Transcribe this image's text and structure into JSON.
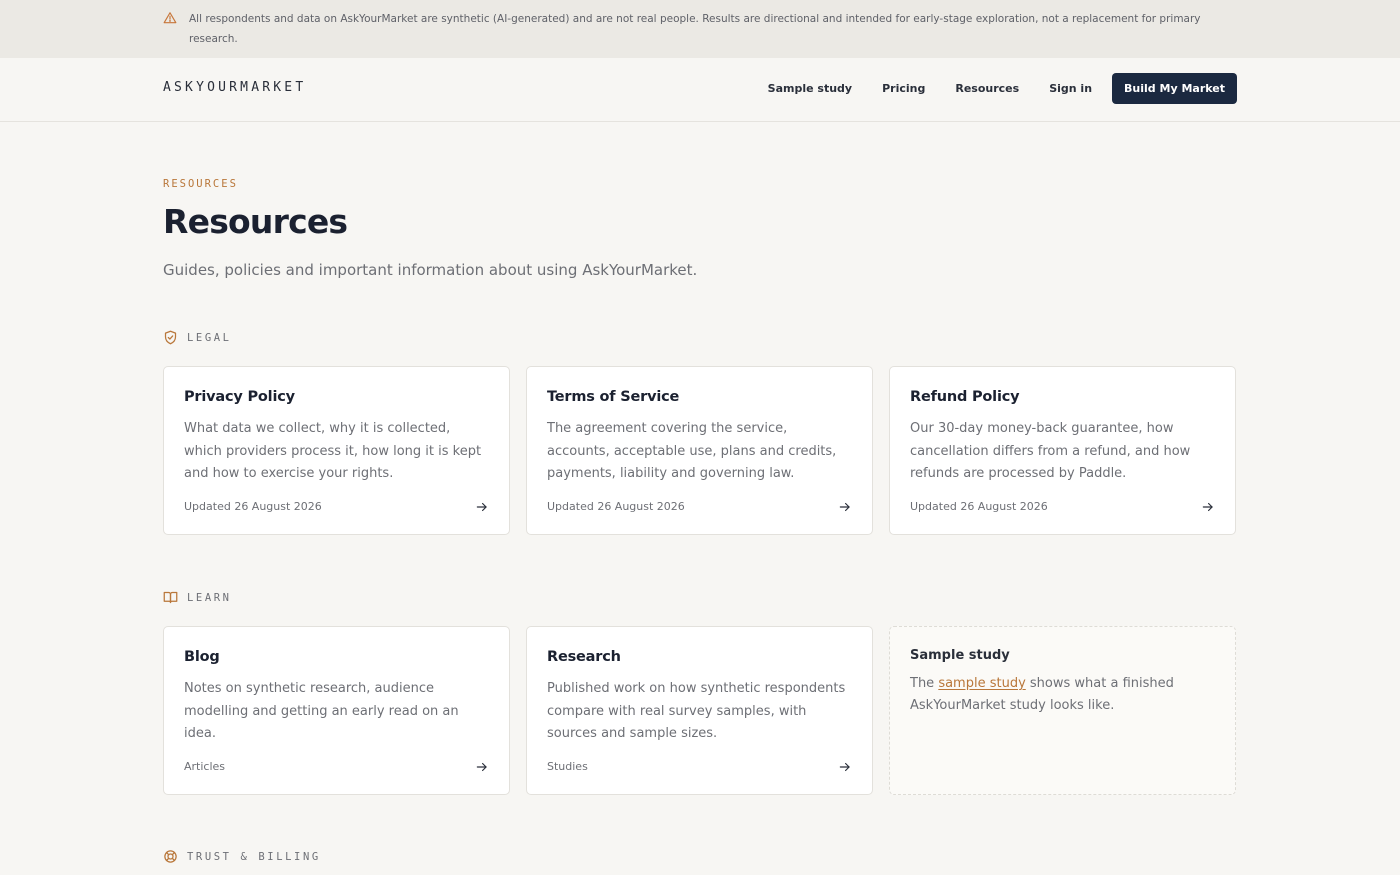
{
  "banner": {
    "text": "All respondents and data on AskYourMarket are synthetic (AI-generated) and are not real people. Results are directional and intended for early-stage exploration, not a replacement for primary research.",
    "icon": "warning-icon"
  },
  "header": {
    "logo": "ASKYOURMARKET",
    "nav": [
      {
        "label": "Sample study"
      },
      {
        "label": "Pricing"
      },
      {
        "label": "Resources"
      },
      {
        "label": "Sign in"
      }
    ],
    "cta": "Build My Market"
  },
  "hero": {
    "eyebrow": "RESOURCES",
    "title": "Resources",
    "subtitle": "Guides, policies and important information about using AskYourMarket."
  },
  "sections": {
    "legal": {
      "label": "LEGAL",
      "icon": "shield-check-icon",
      "cards": [
        {
          "title": "Privacy Policy",
          "description": "What data we collect, why it is collected, which providers process it, how long it is kept and how to exercise your rights.",
          "meta": "Updated 26 August 2026"
        },
        {
          "title": "Terms of Service",
          "description": "The agreement covering the service, accounts, acceptable use, plans and credits, payments, liability and governing law.",
          "meta": "Updated 26 August 2026"
        },
        {
          "title": "Refund Policy",
          "description": "Our 30-day money-back guarantee, how cancellation differs from a refund, and how refunds are processed by Paddle.",
          "meta": "Updated 26 August 2026"
        }
      ]
    },
    "learn": {
      "label": "LEARN",
      "icon": "book-open-icon",
      "cards": [
        {
          "title": "Blog",
          "description": "Notes on synthetic research, audience modelling and getting an early read on an idea.",
          "meta": "Articles"
        },
        {
          "title": "Research",
          "description": "Published work on how synthetic respondents compare with real survey samples, with sources and sample sizes.",
          "meta": "Studies"
        }
      ],
      "sample": {
        "title": "Sample study",
        "before": "The ",
        "link": "sample study",
        "after": " shows what a finished AskYourMarket study looks like."
      }
    },
    "trust": {
      "label": "TRUST & BILLING",
      "icon": "lifebuoy-icon"
    }
  },
  "colors": {
    "accent": "#b9773a",
    "navy": "#1b2940",
    "background": "#f7f6f3"
  }
}
